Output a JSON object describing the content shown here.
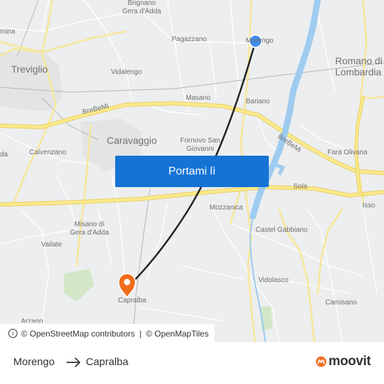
{
  "map": {
    "places": [
      {
        "id": "brignano",
        "text": "Brignano\nGera d'Adda",
        "cls": "",
        "top": 0
      },
      {
        "id": "pagazzano",
        "text": "Pagazzano",
        "cls": ""
      },
      {
        "id": "morengo",
        "text": "Morengo",
        "cls": ""
      },
      {
        "id": "romano",
        "text": "Romano di\nLombardia",
        "cls": "town"
      },
      {
        "id": "treviglio",
        "text": "Treviglio",
        "cls": "town"
      },
      {
        "id": "vidalengo",
        "text": "Vidalengo",
        "cls": ""
      },
      {
        "id": "masano",
        "text": "Masano",
        "cls": ""
      },
      {
        "id": "bariano",
        "text": "Bariano",
        "cls": ""
      },
      {
        "id": "brebemi1",
        "text": "BreBeMi",
        "cls": ""
      },
      {
        "id": "brebemi2",
        "text": "BreBeMi",
        "cls": ""
      },
      {
        "id": "caravaggio",
        "text": "Caravaggio",
        "cls": "town"
      },
      {
        "id": "fornovo",
        "text": "Fornovo San\nGiovanni",
        "cls": ""
      },
      {
        "id": "calvenzano",
        "text": "Calvenzano",
        "cls": ""
      },
      {
        "id": "fara",
        "text": "Fara Olivana",
        "cls": ""
      },
      {
        "id": "sola",
        "text": "Sola",
        "cls": ""
      },
      {
        "id": "isso",
        "text": "Isso",
        "cls": ""
      },
      {
        "id": "mozzanica",
        "text": "Mozzanica",
        "cls": ""
      },
      {
        "id": "castel",
        "text": "Castel Gabbiano",
        "cls": ""
      },
      {
        "id": "misano",
        "text": "Misano di\nGera d'Adda",
        "cls": ""
      },
      {
        "id": "vailate",
        "text": "Vailate",
        "cls": ""
      },
      {
        "id": "vidolasco",
        "text": "Vidolasco",
        "cls": ""
      },
      {
        "id": "camisano",
        "text": "Camisano",
        "cls": ""
      },
      {
        "id": "capralba",
        "text": "Capralba",
        "cls": ""
      },
      {
        "id": "mina",
        "text": "mina",
        "cls": ""
      },
      {
        "id": "da",
        "text": "da",
        "cls": ""
      },
      {
        "id": "arzago",
        "text": "Arzago",
        "cls": ""
      }
    ],
    "cta_label": "Portami lì",
    "origin_color": "#3d8ef0",
    "destination_color": "#f06d1a",
    "route_color": "#222222"
  },
  "attribution": {
    "osm": "© OpenStreetMap contributors",
    "omt": "© OpenMapTiles",
    "sep": "|"
  },
  "footer": {
    "from": "Morengo",
    "to": "Capralba",
    "brand": "moovit",
    "brand_color": "#f36f21"
  }
}
